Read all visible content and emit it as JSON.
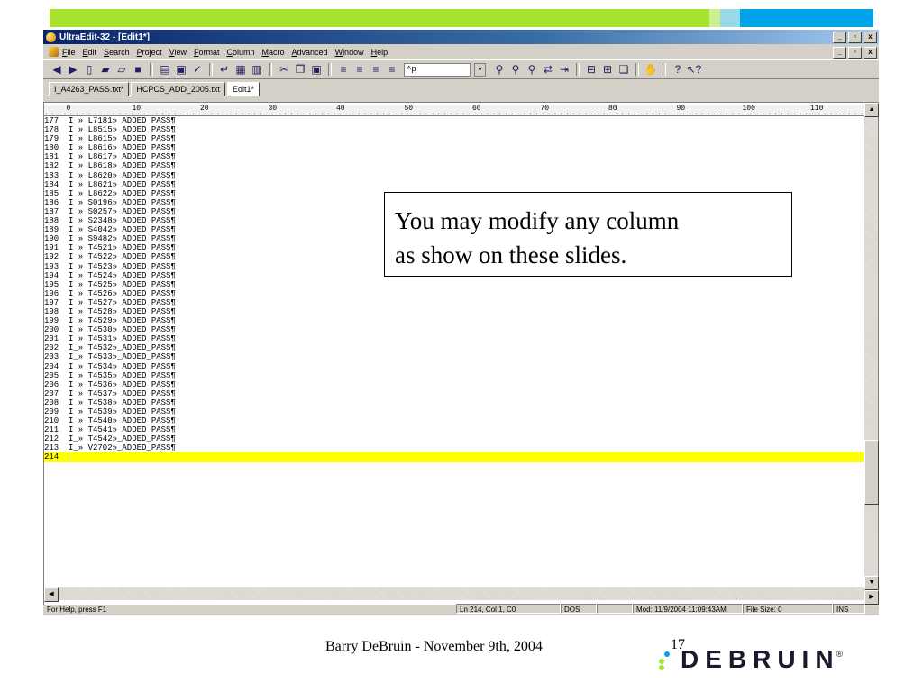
{
  "colors": {
    "band": [
      "#a6e22e",
      "#a6e22e",
      "#c8f08e",
      "#99d9ea",
      "#00a2e8"
    ],
    "current_line": "#ffff00",
    "title_start": "#0a246a",
    "logo_dots": [
      "#00a2e8",
      "#a6e22e",
      "#a6e22e"
    ]
  },
  "window": {
    "title": "UltraEdit-32 - [Edit1*]",
    "buttons": [
      "_",
      "▫",
      "x"
    ],
    "mdi_buttons": [
      "_",
      "▫",
      "x"
    ]
  },
  "menu": [
    "File",
    "Edit",
    "Search",
    "Project",
    "View",
    "Format",
    "Column",
    "Macro",
    "Advanced",
    "Window",
    "Help"
  ],
  "toolbar": {
    "icons": [
      "back-icon",
      "forward-icon",
      "new-file-icon",
      "open-folder-icon",
      "open-icon",
      "save-icon",
      "print-icon",
      "print-preview-icon",
      "spell-check-icon",
      "word-wrap-icon",
      "hex-edit-icon",
      "column-mode-icon",
      "cut-icon",
      "copy-icon",
      "paste-icon",
      "align-left-icon",
      "align-center-icon",
      "align-right-icon",
      "justify-icon"
    ],
    "search_value": "^p",
    "icons2": [
      "find-icon",
      "find-next-icon",
      "find-prev-icon",
      "replace-icon",
      "goto-icon",
      "split-horizontal-icon",
      "split-vertical-icon",
      "cascade-icon",
      "tag-list-icon",
      "help-icon",
      "context-help-icon"
    ]
  },
  "tabs": [
    "I_A4263_PASS.txt*",
    "HCPCS_ADD_2005.txt",
    "Edit1*"
  ],
  "ruler": [
    "0",
    "10",
    "20",
    "30",
    "40",
    "50",
    "60",
    "70",
    "80",
    "90",
    "100",
    "110",
    "120"
  ],
  "editor": {
    "lines": [
      {
        "n": "177",
        "text": "I_» L7181»_ADDED_PASS¶"
      },
      {
        "n": "178",
        "text": "I_» L8515»_ADDED_PASS¶"
      },
      {
        "n": "179",
        "text": "I_» L8615»_ADDED_PASS¶"
      },
      {
        "n": "180",
        "text": "I_» L8616»_ADDED_PASS¶"
      },
      {
        "n": "181",
        "text": "I_» L8617»_ADDED_PASS¶"
      },
      {
        "n": "182",
        "text": "I_» L8618»_ADDED_PASS¶"
      },
      {
        "n": "183",
        "text": "I_» L8620»_ADDED_PASS¶"
      },
      {
        "n": "184",
        "text": "I_» L8621»_ADDED_PASS¶"
      },
      {
        "n": "185",
        "text": "I_» L8622»_ADDED_PASS¶"
      },
      {
        "n": "186",
        "text": "I_» S0196»_ADDED_PASS¶"
      },
      {
        "n": "187",
        "text": "I_» S0257»_ADDED_PASS¶"
      },
      {
        "n": "188",
        "text": "I_» S2348»_ADDED_PASS¶"
      },
      {
        "n": "189",
        "text": "I_» S4042»_ADDED_PASS¶"
      },
      {
        "n": "190",
        "text": "I_» S9482»_ADDED_PASS¶"
      },
      {
        "n": "191",
        "text": "I_» T4521»_ADDED_PASS¶"
      },
      {
        "n": "192",
        "text": "I_» T4522»_ADDED_PASS¶"
      },
      {
        "n": "193",
        "text": "I_» T4523»_ADDED_PASS¶"
      },
      {
        "n": "194",
        "text": "I_» T4524»_ADDED_PASS¶"
      },
      {
        "n": "195",
        "text": "I_» T4525»_ADDED_PASS¶"
      },
      {
        "n": "196",
        "text": "I_» T4526»_ADDED_PASS¶"
      },
      {
        "n": "197",
        "text": "I_» T4527»_ADDED_PASS¶"
      },
      {
        "n": "198",
        "text": "I_» T4528»_ADDED_PASS¶"
      },
      {
        "n": "199",
        "text": "I_» T4529»_ADDED_PASS¶"
      },
      {
        "n": "200",
        "text": "I_» T4530»_ADDED_PASS¶"
      },
      {
        "n": "201",
        "text": "I_» T4531»_ADDED_PASS¶"
      },
      {
        "n": "202",
        "text": "I_» T4532»_ADDED_PASS¶"
      },
      {
        "n": "203",
        "text": "I_» T4533»_ADDED_PASS¶"
      },
      {
        "n": "204",
        "text": "I_» T4534»_ADDED_PASS¶"
      },
      {
        "n": "205",
        "text": "I_» T4535»_ADDED_PASS¶"
      },
      {
        "n": "206",
        "text": "I_» T4536»_ADDED_PASS¶"
      },
      {
        "n": "207",
        "text": "I_» T4537»_ADDED_PASS¶"
      },
      {
        "n": "208",
        "text": "I_» T4538»_ADDED_PASS¶"
      },
      {
        "n": "209",
        "text": "I_» T4539»_ADDED_PASS¶"
      },
      {
        "n": "210",
        "text": "I_» T4540»_ADDED_PASS¶"
      },
      {
        "n": "211",
        "text": "I_» T4541»_ADDED_PASS¶"
      },
      {
        "n": "212",
        "text": "I_» T4542»_ADDED_PASS¶"
      },
      {
        "n": "213",
        "text": "I_» V2702»_ADDED_PASS¶"
      },
      {
        "n": "214",
        "text": ""
      }
    ],
    "current_line": "214"
  },
  "status": {
    "help": "For Help, press F1",
    "position": "Ln 214, Col 1, C0",
    "format": "DOS",
    "modified": "Mod: 11/9/2004 11:09:43AM",
    "file_size": "File Size: 0",
    "mode": "INS"
  },
  "callout": {
    "line1": "You may modify any column",
    "line2": "as show on these slides."
  },
  "footer": {
    "text": "Barry DeBruin - November 9th, 2004",
    "page": "17",
    "logo": "DEBRUIN",
    "reg": "®"
  }
}
